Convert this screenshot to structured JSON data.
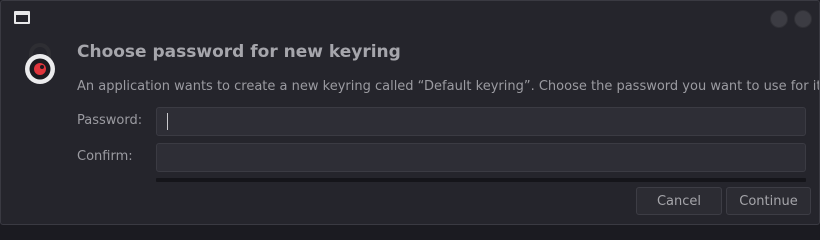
{
  "dialog": {
    "heading": "Choose password for new keyring",
    "message": "An application wants to create a new keyring called “Default keyring”. Choose the password you want to use for it."
  },
  "fields": {
    "password": {
      "label": "Password:",
      "value": ""
    },
    "confirm": {
      "label": "Confirm:",
      "value": ""
    }
  },
  "buttons": {
    "cancel": "Cancel",
    "continue": "Continue"
  },
  "icons": {
    "app": "window-icon",
    "lock": "lock-icon"
  },
  "colors": {
    "accent": "#e0353c",
    "background": "#25252c"
  }
}
